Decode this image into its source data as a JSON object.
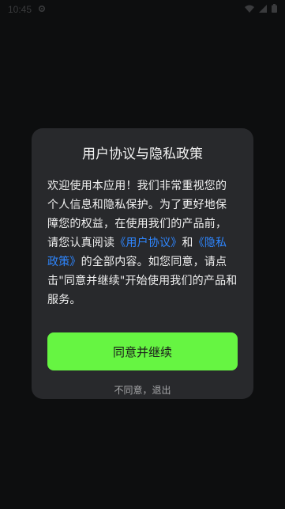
{
  "statusbar": {
    "time": "10:45",
    "icons": [
      "gear-icon",
      "wifi-icon",
      "signal-icon",
      "battery-icon"
    ]
  },
  "dialog": {
    "title": "用户协议与隐私政策",
    "body": {
      "part1": "欢迎使用本应用！我们非常重视您的个人信息和隐私保护。为了更好地保障您的权益，在使用我们的产品前，请您认真阅读",
      "link_agreement": "《用户协议》",
      "and": "和",
      "link_privacy": "《隐私政策》",
      "part2": "的全部内容。如您同意，请点击\"同意并继续\"开始使用我们的产品和服务。"
    },
    "agree_label": "同意并继续",
    "decline_label": "不同意，退出"
  },
  "colors": {
    "background": "#0d0e0f",
    "dialog": "#28292c",
    "accent_button": "#66f542",
    "link": "#2e86ff"
  }
}
